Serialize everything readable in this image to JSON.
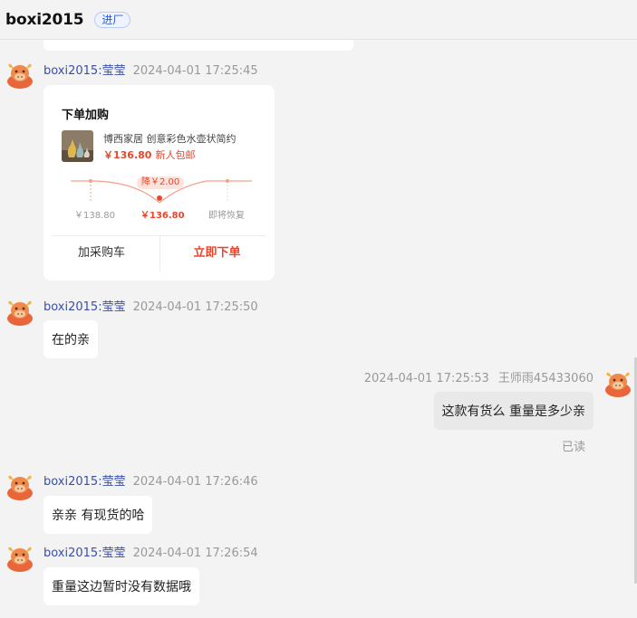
{
  "header": {
    "title": "boxi2015",
    "badge": "进厂"
  },
  "order_card": {
    "title": "下单加购",
    "product_name": "博西家居 创意彩色水壶状简约",
    "price": "￥136.80",
    "promo_tag": "新人包邮",
    "price_drop": "降￥2.00",
    "price_before": "￥138.80",
    "price_now": "￥136.80",
    "price_future": "即将恢复",
    "cart_button": "加采购车",
    "buy_button": "立即下单"
  },
  "messages": [
    {
      "sender": "boxi2015:莹莹",
      "time": "2024-04-01 17:25:45"
    },
    {
      "sender": "boxi2015:莹莹",
      "time": "2024-04-01 17:25:50",
      "text": "在的亲"
    },
    {
      "sender": "王师雨45433060",
      "time": "2024-04-01 17:25:53",
      "text": "这款有货么 重量是多少亲",
      "status": "已读"
    },
    {
      "sender": "boxi2015:莹莹",
      "time": "2024-04-01 17:26:46",
      "text": "亲亲 有现货的哈"
    },
    {
      "sender": "boxi2015:莹莹",
      "time": "2024-04-01 17:26:54",
      "text": "重量这边暂时没有数据哦"
    }
  ],
  "icons": {
    "avatar": "bull-avatar-icon",
    "product_thumb": "vase-thumbnail"
  },
  "colors": {
    "accent": "#e8462b",
    "name_link": "#3b4fa8",
    "badge_blue": "#2a5bd7"
  }
}
